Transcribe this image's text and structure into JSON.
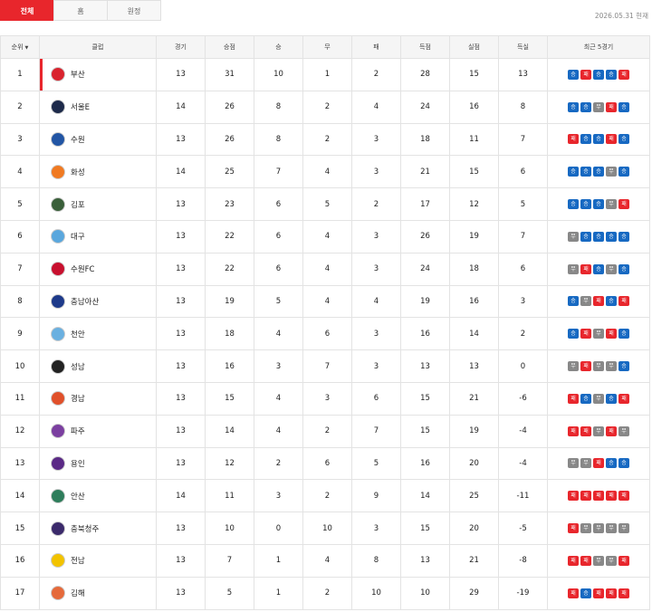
{
  "tabs": [
    {
      "label": "전체",
      "active": true
    },
    {
      "label": "홈",
      "active": false
    },
    {
      "label": "원정",
      "active": false
    }
  ],
  "date_text": "2026.05.31 현재",
  "headers": {
    "rank": "순위",
    "club": "클럽",
    "played": "경기",
    "points": "승점",
    "win": "승",
    "draw": "무",
    "loss": "패",
    "gf": "득점",
    "ga": "실점",
    "gd": "득실",
    "recent": "최근 5경기"
  },
  "form_labels": {
    "w": "승",
    "d": "무",
    "l": "패"
  },
  "rows": [
    {
      "rank": "1",
      "club": "부산",
      "played": "13",
      "points": "31",
      "win": "10",
      "draw": "1",
      "loss": "2",
      "gf": "28",
      "ga": "15",
      "gd": "13",
      "form": [
        "w",
        "l",
        "w",
        "w",
        "l"
      ],
      "logo_color": "#d9232e"
    },
    {
      "rank": "2",
      "club": "서울E",
      "played": "14",
      "points": "26",
      "win": "8",
      "draw": "2",
      "loss": "4",
      "gf": "24",
      "ga": "16",
      "gd": "8",
      "form": [
        "w",
        "w",
        "d",
        "l",
        "w"
      ],
      "logo_color": "#1d2a4a"
    },
    {
      "rank": "3",
      "club": "수원",
      "played": "13",
      "points": "26",
      "win": "8",
      "draw": "2",
      "loss": "3",
      "gf": "18",
      "ga": "11",
      "gd": "7",
      "form": [
        "l",
        "w",
        "w",
        "l",
        "w"
      ],
      "logo_color": "#2255a4"
    },
    {
      "rank": "4",
      "club": "화성",
      "played": "14",
      "points": "25",
      "win": "7",
      "draw": "4",
      "loss": "3",
      "gf": "21",
      "ga": "15",
      "gd": "6",
      "form": [
        "w",
        "w",
        "w",
        "d",
        "w"
      ],
      "logo_color": "#f07a22"
    },
    {
      "rank": "5",
      "club": "김포",
      "played": "13",
      "points": "23",
      "win": "6",
      "draw": "5",
      "loss": "2",
      "gf": "17",
      "ga": "12",
      "gd": "5",
      "form": [
        "w",
        "w",
        "w",
        "d",
        "l"
      ],
      "logo_color": "#3a5f3a"
    },
    {
      "rank": "6",
      "club": "대구",
      "played": "13",
      "points": "22",
      "win": "6",
      "draw": "4",
      "loss": "3",
      "gf": "26",
      "ga": "19",
      "gd": "7",
      "form": [
        "d",
        "w",
        "w",
        "w",
        "w"
      ],
      "logo_color": "#5aa7dd"
    },
    {
      "rank": "7",
      "club": "수원FC",
      "played": "13",
      "points": "22",
      "win": "6",
      "draw": "4",
      "loss": "3",
      "gf": "24",
      "ga": "18",
      "gd": "6",
      "form": [
        "d",
        "l",
        "w",
        "d",
        "w"
      ],
      "logo_color": "#c8102e"
    },
    {
      "rank": "8",
      "club": "충남아산",
      "played": "13",
      "points": "19",
      "win": "5",
      "draw": "4",
      "loss": "4",
      "gf": "19",
      "ga": "16",
      "gd": "3",
      "form": [
        "w",
        "d",
        "l",
        "w",
        "l"
      ],
      "logo_color": "#1e3a8a"
    },
    {
      "rank": "9",
      "club": "천안",
      "played": "13",
      "points": "18",
      "win": "4",
      "draw": "6",
      "loss": "3",
      "gf": "16",
      "ga": "14",
      "gd": "2",
      "form": [
        "w",
        "l",
        "d",
        "l",
        "w"
      ],
      "logo_color": "#6ab0e0"
    },
    {
      "rank": "10",
      "club": "성남",
      "played": "13",
      "points": "16",
      "win": "3",
      "draw": "7",
      "loss": "3",
      "gf": "13",
      "ga": "13",
      "gd": "0",
      "form": [
        "d",
        "l",
        "d",
        "d",
        "w"
      ],
      "logo_color": "#222222"
    },
    {
      "rank": "11",
      "club": "경남",
      "played": "13",
      "points": "15",
      "win": "4",
      "draw": "3",
      "loss": "6",
      "gf": "15",
      "ga": "21",
      "gd": "-6",
      "form": [
        "l",
        "w",
        "d",
        "w",
        "l"
      ],
      "logo_color": "#e0502a"
    },
    {
      "rank": "12",
      "club": "파주",
      "played": "13",
      "points": "14",
      "win": "4",
      "draw": "2",
      "loss": "7",
      "gf": "15",
      "ga": "19",
      "gd": "-4",
      "form": [
        "l",
        "l",
        "d",
        "l",
        "d"
      ],
      "logo_color": "#7b3fa0"
    },
    {
      "rank": "13",
      "club": "용인",
      "played": "13",
      "points": "12",
      "win": "2",
      "draw": "6",
      "loss": "5",
      "gf": "16",
      "ga": "20",
      "gd": "-4",
      "form": [
        "d",
        "d",
        "l",
        "w",
        "w"
      ],
      "logo_color": "#5b2a86"
    },
    {
      "rank": "14",
      "club": "안산",
      "played": "14",
      "points": "11",
      "win": "3",
      "draw": "2",
      "loss": "9",
      "gf": "14",
      "ga": "25",
      "gd": "-11",
      "form": [
        "l",
        "l",
        "l",
        "l",
        "l"
      ],
      "logo_color": "#2e7d5b"
    },
    {
      "rank": "15",
      "club": "충북청주",
      "played": "13",
      "points": "10",
      "win": "0",
      "draw": "10",
      "loss": "3",
      "gf": "15",
      "ga": "20",
      "gd": "-5",
      "form": [
        "l",
        "d",
        "d",
        "d",
        "d"
      ],
      "logo_color": "#3b2a6b"
    },
    {
      "rank": "16",
      "club": "전남",
      "played": "13",
      "points": "7",
      "win": "1",
      "draw": "4",
      "loss": "8",
      "gf": "13",
      "ga": "21",
      "gd": "-8",
      "form": [
        "l",
        "l",
        "d",
        "d",
        "l"
      ],
      "logo_color": "#f2c300"
    },
    {
      "rank": "17",
      "club": "김해",
      "played": "13",
      "points": "5",
      "win": "1",
      "draw": "2",
      "loss": "10",
      "gf": "10",
      "ga": "29",
      "gd": "-19",
      "form": [
        "l",
        "w",
        "l",
        "l",
        "l"
      ],
      "logo_color": "#e56a3b"
    }
  ]
}
